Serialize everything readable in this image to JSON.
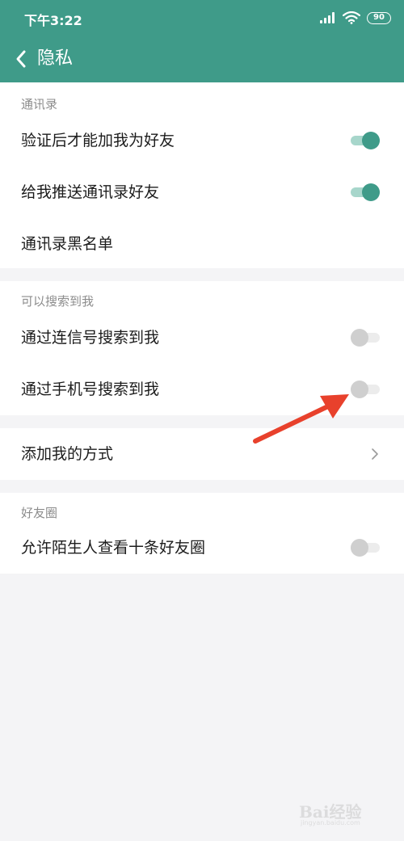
{
  "status_bar": {
    "time": "下午3:22",
    "battery": "90",
    "icons": [
      "signal-icon",
      "wifi-icon",
      "battery-icon"
    ]
  },
  "nav": {
    "title": "隐私",
    "back_icon": "chevron-left-icon"
  },
  "sections": {
    "contacts": {
      "header": "通讯录",
      "items": [
        {
          "label": "验证后才能加我为好友",
          "toggle": "on"
        },
        {
          "label": "给我推送通讯录好友",
          "toggle": "on"
        },
        {
          "label": "通讯录黑名单"
        }
      ]
    },
    "search": {
      "header": "可以搜索到我",
      "items": [
        {
          "label": "通过连信号搜索到我",
          "toggle": "off"
        },
        {
          "label": "通过手机号搜索到我",
          "toggle": "off"
        }
      ]
    },
    "add_method": {
      "items": [
        {
          "label": "添加我的方式"
        }
      ]
    },
    "moments": {
      "header": "好友圈",
      "items": [
        {
          "label": "允许陌生人查看十条好友圈",
          "toggle": "off"
        }
      ]
    }
  },
  "colors": {
    "brand": "#3f9b89",
    "toggle_on_track": "#a7d6cb",
    "toggle_off_knob": "#cfcfcf",
    "annotation_arrow": "#e8412c",
    "background": "#f4f4f6"
  },
  "watermark": {
    "text": "Bai经验",
    "sub": "jingyan.baidu.com"
  }
}
